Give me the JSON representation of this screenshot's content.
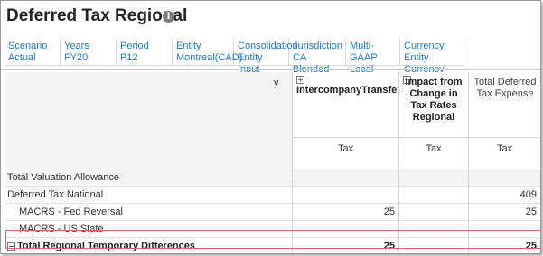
{
  "form": {
    "title": "Deferred Tax Regional",
    "info_icon": "info-icon"
  },
  "pov": [
    {
      "label": "Scenario",
      "value": "Actual"
    },
    {
      "label": "Years",
      "value": "FY20"
    },
    {
      "label": "Period",
      "value": "P12"
    },
    {
      "label": "Entity",
      "value": "Montreal(CAD)"
    },
    {
      "label": "Consolidation",
      "value": "Entity Input"
    },
    {
      "label": "Jurisdiction",
      "value": "CA Blended"
    },
    {
      "label": "Multi-GAAP",
      "value": "Local GAAP"
    },
    {
      "label": "Currency",
      "value": "Entity Currency"
    }
  ],
  "grid": {
    "row_header_fragment": "y",
    "columns": [
      {
        "header": "IntercompanyTransfers",
        "sub": "Tax",
        "expandable": true
      },
      {
        "header": "Impact from Change in Tax Rates Regional",
        "sub": "Tax",
        "expandable": true
      },
      {
        "header": "Total Deferred Tax Expense",
        "sub": "Tax",
        "expandable": false
      }
    ],
    "rows": [
      {
        "label": "Total Valuation Allowance",
        "values": [
          "",
          "",
          ""
        ],
        "indent": false,
        "bold": false
      },
      {
        "label": "Deferred Tax National",
        "values": [
          "",
          "",
          "409"
        ],
        "indent": false,
        "bold": false
      },
      {
        "label": "MACRS - Fed Reversal",
        "values": [
          "25",
          "",
          "25"
        ],
        "indent": true,
        "bold": false
      },
      {
        "label": "MACRS - US State",
        "values": [
          "",
          "",
          ""
        ],
        "indent": true,
        "bold": false
      },
      {
        "label": "Total Regional Temporary Differences",
        "values": [
          "25",
          "",
          "25"
        ],
        "indent": false,
        "bold": true,
        "collapse_icon": "−"
      }
    ]
  }
}
